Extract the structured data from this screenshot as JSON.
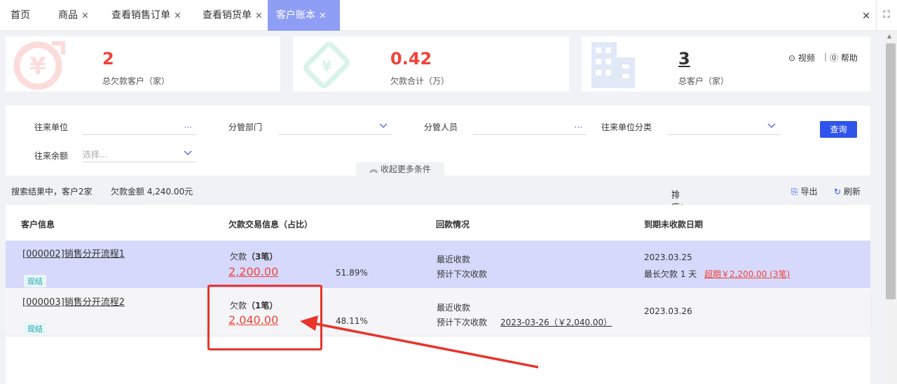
{
  "tabs": [
    {
      "label": "首页",
      "closable": false
    },
    {
      "label": "商品",
      "closable": true
    },
    {
      "label": "查看销售订单",
      "closable": true
    },
    {
      "label": "查看销货单",
      "closable": true
    },
    {
      "label": "客户账本",
      "closable": true,
      "active": true
    }
  ],
  "tab_close_glyph": "×",
  "window": {
    "close_glyph": "×",
    "fullscreen_glyph": "⛶"
  },
  "stats": [
    {
      "value": "2",
      "label": "总欠款客户（家）",
      "color": "#f0433a",
      "icon": "yen-coin-icon"
    },
    {
      "value": "0.42",
      "label": "欠款合计（万）",
      "color": "#f0433a",
      "icon": "ticket-icon"
    },
    {
      "value": "3",
      "label": "总客户（家）",
      "color": "#333333",
      "icon": "building-icon"
    }
  ],
  "help": {
    "video": "视频",
    "separator": "|",
    "help": "帮助"
  },
  "filters": {
    "partner": {
      "label": "往来单位",
      "suffix": "···"
    },
    "dept": {
      "label": "分管部门"
    },
    "staff": {
      "label": "分管人员",
      "suffix": "···"
    },
    "category": {
      "label": "往来单位分类"
    },
    "balance": {
      "label": "往来余额",
      "placeholder": "选择..."
    },
    "query_button": "查询",
    "collapse": "收起更多条件"
  },
  "summary": {
    "result_text": "搜索结果中，客户2家",
    "debt_text": "欠款金额 4,240.00元",
    "sort": "排序：按欠款金额倒序排序",
    "export": "导出",
    "refresh": "刷新"
  },
  "table": {
    "headers": [
      "客户信息",
      "欠款交易信息（占比）",
      "回款情况",
      "到期未收款日期"
    ],
    "rows": [
      {
        "name": "[000002]销售分开流程1",
        "tag": "现结",
        "debt_label": "欠款",
        "debt_count": "（3笔）",
        "amount": "2,200.00",
        "ratio": "51.89%",
        "recent": "最近收款",
        "next": "预计下次收款",
        "next_detail": "",
        "due_date": "2023.03.25",
        "longest": "最长欠款 1 天",
        "overdue": "超期￥2,200.00 (3笔)"
      },
      {
        "name": "[000003]销售分开流程2",
        "tag": "现结",
        "debt_label": "欠款",
        "debt_count": "（1笔）",
        "amount": "2,040.00",
        "ratio": "48.11%",
        "recent": "最近收款",
        "next": "预计下次收款",
        "next_detail": "2023-03-26（￥2,040.00）",
        "due_date": "2023.03.26",
        "longest": "",
        "overdue": ""
      }
    ]
  },
  "annotation_color": "#e8342b"
}
